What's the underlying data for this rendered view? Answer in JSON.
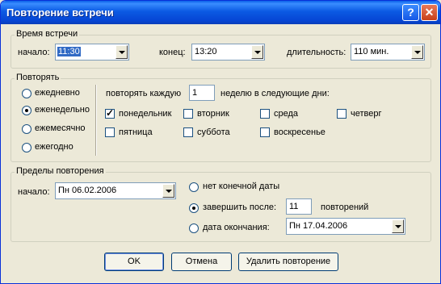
{
  "window": {
    "title": "Повторение встречи",
    "help_label": "?",
    "close_label": "✕"
  },
  "time_group": {
    "legend": "Время встречи",
    "start_label": "начало:",
    "start_value": "11:30",
    "end_label": "конец:",
    "end_value": "13:20",
    "duration_label": "длительность:",
    "duration_value": "110 мин."
  },
  "repeat_group": {
    "legend": "Повторять",
    "options": [
      "ежедневно",
      "еженедельно",
      "ежемесячно",
      "ежегодно"
    ],
    "selected": "еженедельно",
    "every_label": "повторять каждую",
    "every_value": "1",
    "weeks_label": "неделю в следующие дни:",
    "days": [
      {
        "label": "понедельник",
        "checked": true
      },
      {
        "label": "вторник",
        "checked": false
      },
      {
        "label": "среда",
        "checked": false
      },
      {
        "label": "четверг",
        "checked": false
      },
      {
        "label": "пятница",
        "checked": false
      },
      {
        "label": "суббота",
        "checked": false
      },
      {
        "label": "воскресенье",
        "checked": false
      }
    ]
  },
  "range_group": {
    "legend": "Пределы повторения",
    "start_label": "начало:",
    "start_value": "Пн 06.02.2006",
    "no_end_label": "нет конечной даты",
    "end_after_label": "завершить после:",
    "end_after_value": "11",
    "occurrences_label": "повторений",
    "end_by_label": "дата окончания:",
    "end_by_value": "Пн 17.04.2006",
    "selected": "end_after"
  },
  "buttons": {
    "ok": "OK",
    "cancel": "Отмена",
    "remove": "Удалить повторение"
  }
}
